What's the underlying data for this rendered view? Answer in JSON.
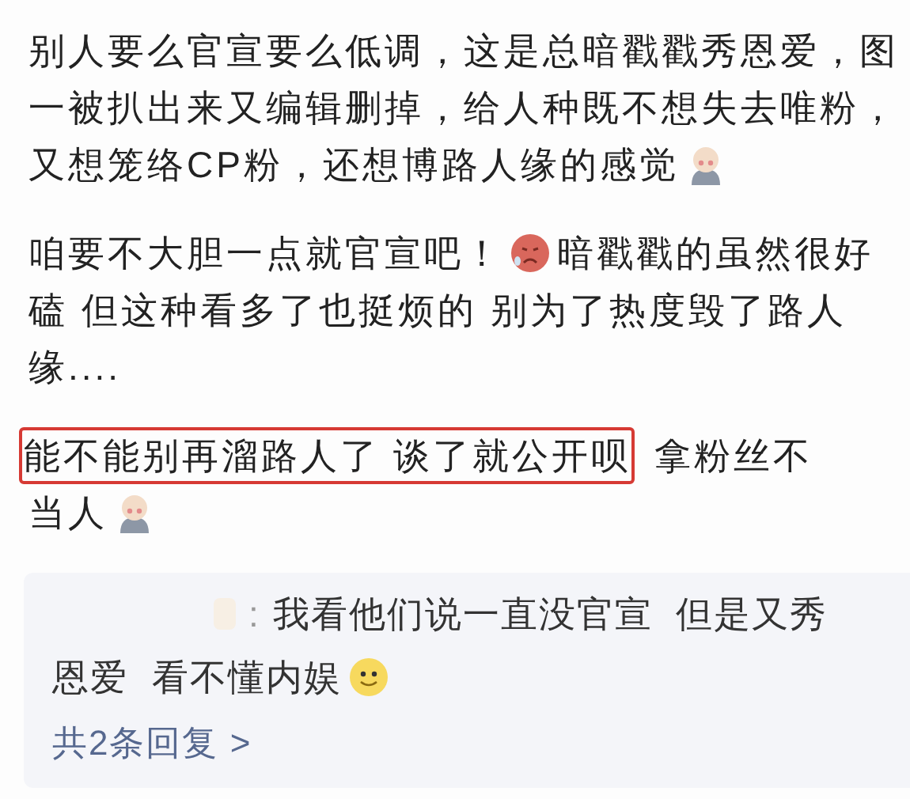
{
  "comment": {
    "paragraphs": [
      [
        [
          {
            "kind": "text",
            "text": "别人要么官宣要么低调，这是总暗戳戳秀恩爱，图",
            "highlighted": false
          }
        ],
        [
          {
            "kind": "text",
            "text": "一被扒出来又编辑删掉，给人种既不想失去唯粉，",
            "highlighted": false
          }
        ],
        [
          {
            "kind": "text",
            "text": "又想笼络CP粉，还想博路人缘的感觉",
            "highlighted": false
          },
          {
            "kind": "figure"
          }
        ]
      ],
      [
        [
          {
            "kind": "text",
            "text": "咱要不大胆一点就官宣吧！",
            "highlighted": false
          },
          {
            "kind": "flushed"
          },
          {
            "kind": "text",
            "text": "暗戳戳的虽然很好",
            "highlighted": false
          }
        ],
        [
          {
            "kind": "text",
            "text": "磕 但这种看多了也挺烦的 别为了热度毁了路人",
            "highlighted": false
          }
        ],
        [
          {
            "kind": "text",
            "text": "缘....",
            "highlighted": false
          }
        ]
      ],
      [
        [
          {
            "kind": "text",
            "text": "能不能别再溜路人了 谈了就公开呗",
            "highlighted": true
          },
          {
            "kind": "text",
            "text": "拿粉丝不",
            "highlighted": false
          }
        ],
        [
          {
            "kind": "text",
            "text": "当人",
            "highlighted": false
          },
          {
            "kind": "figure"
          }
        ]
      ]
    ]
  },
  "reply": {
    "separator": ":",
    "lines": [
      [
        {
          "kind": "text",
          "text": "我看他们说一直没官宣  但是又秀"
        }
      ],
      [
        {
          "kind": "text",
          "text": "恩爱  看不懂内娱"
        },
        {
          "kind": "smiley"
        }
      ]
    ],
    "more_link": "共2条回复 >"
  }
}
